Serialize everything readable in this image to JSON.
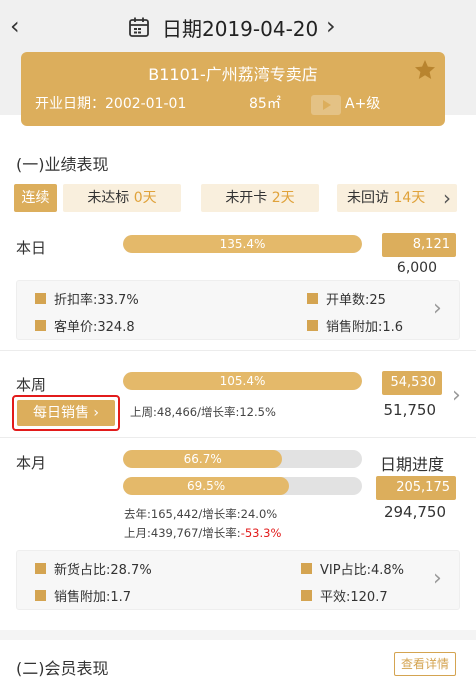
{
  "header": {
    "back_icon": "chevron-left-icon",
    "date_label": "日期2019-04-20",
    "forward_icon": "chevron-right-icon"
  },
  "store": {
    "name": "B1101-广州荔湾专卖店",
    "open_date": "开业日期：2002-01-01",
    "area": "85㎡",
    "level": "A+级",
    "star_icon": "star-icon"
  },
  "section1": {
    "title": "(一)业绩表现"
  },
  "tags": {
    "continuous": "连续",
    "items": [
      {
        "label": "未达标",
        "count": "0天"
      },
      {
        "label": "未开卡",
        "count": "2天"
      },
      {
        "label": "未回访",
        "count": "14天"
      }
    ]
  },
  "today": {
    "label": "本日",
    "percent": "135.4%",
    "fill": 1.0,
    "value": "8,121",
    "target": "6,000",
    "stats": [
      "折扣率:33.7%",
      "开单数:25",
      "客单价:324.8",
      "销售附加:1.6"
    ]
  },
  "week": {
    "label": "本周",
    "percent": "105.4%",
    "fill": 1.0,
    "value": "54,530",
    "target": "51,750",
    "daily_sales": "每日销售",
    "compare": "上周:48,466/增长率:12.5%"
  },
  "month": {
    "label": "本月",
    "progress_title": "日期进度",
    "bar1": {
      "percent": "66.7%",
      "fill": 0.667
    },
    "bar2": {
      "percent": "69.5%",
      "fill": 0.695
    },
    "value": "205,175",
    "target": "294,750",
    "last_year": "去年:165,442/增长率:24.0%",
    "last_month_prefix": "上月:439,767/增长率:",
    "last_month_rate": "-53.3%",
    "stats": [
      "新货占比:28.7%",
      "VIP占比:4.8%",
      "销售附加:1.7",
      "平效:120.7"
    ]
  },
  "section2": {
    "title": "(二)会员表现",
    "detail_button": "查看详情"
  },
  "colors": {
    "accent": "#dcae5c",
    "bar": "#e4b96a",
    "highlight_red": "#e21b1b"
  }
}
